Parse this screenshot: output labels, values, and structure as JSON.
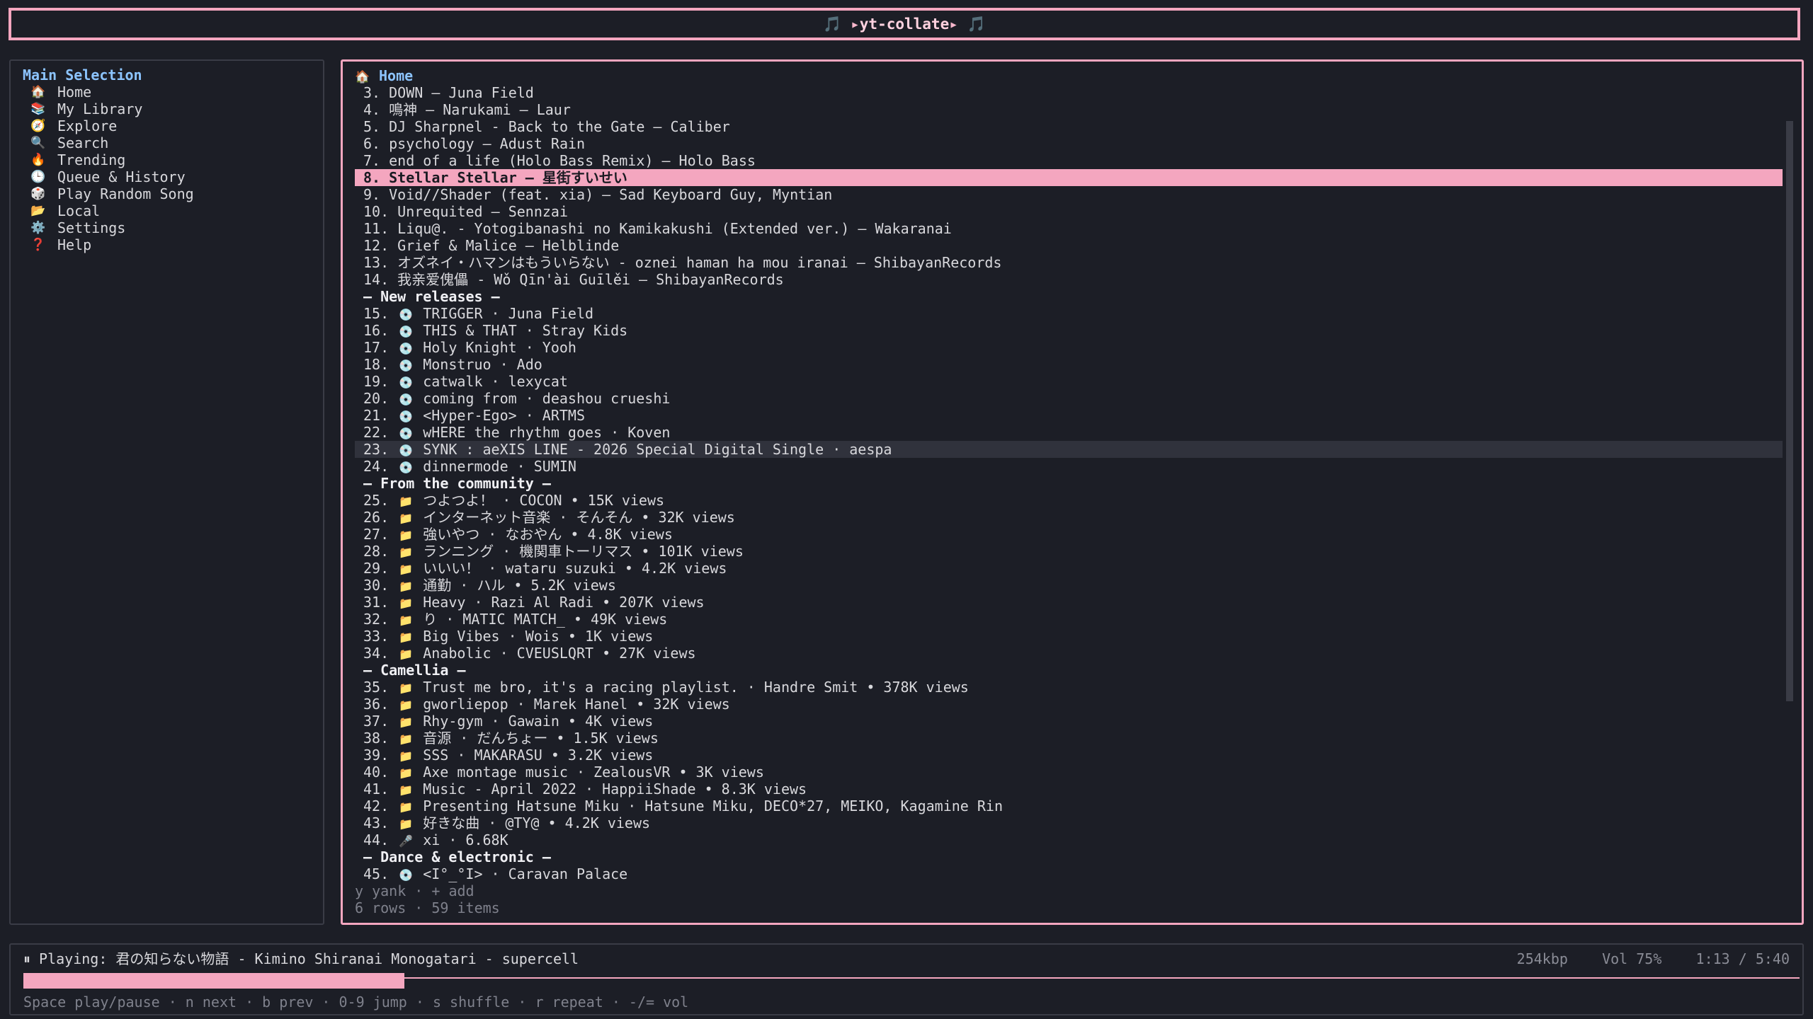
{
  "app_title": "yt-collate",
  "title_prefix": "🎵 ▸ ",
  "title_suffix": " ▸ 🎵",
  "colors": {
    "accent": "#f4a6bf",
    "heading": "#8cc4ff",
    "background": "#1c1e26"
  },
  "sidebar": {
    "heading": "Main Selection",
    "items": [
      {
        "icon": "🏠",
        "label": "Home"
      },
      {
        "icon": "📚",
        "label": "My Library"
      },
      {
        "icon": "🧭",
        "label": "Explore"
      },
      {
        "icon": "🔍",
        "label": "Search"
      },
      {
        "icon": "🔥",
        "label": "Trending"
      },
      {
        "icon": "🕒",
        "label": "Queue & History"
      },
      {
        "icon": "🎲",
        "label": "Play Random Song"
      },
      {
        "icon": "📂",
        "label": "Local"
      },
      {
        "icon": "⚙️",
        "label": "Settings"
      },
      {
        "icon": "❓",
        "label": "Help"
      }
    ]
  },
  "main": {
    "heading_icon": "🏠",
    "heading": "Home",
    "rows": [
      {
        "type": "item",
        "num": "3.",
        "text": "DOWN — Juna Field"
      },
      {
        "type": "item",
        "num": "4.",
        "text": "鳴神 — Narukami — Laur"
      },
      {
        "type": "item",
        "num": "5.",
        "text": "DJ Sharpnel - Back to the Gate — Caliber"
      },
      {
        "type": "item",
        "num": "6.",
        "text": "psychology — Adust Rain"
      },
      {
        "type": "item",
        "num": "7.",
        "text": "end of a life (Holo Bass Remix) — Holo Bass"
      },
      {
        "type": "item",
        "num": "8.",
        "text": "Stellar Stellar — 星街すいせい",
        "state": "selected"
      },
      {
        "type": "item",
        "num": "9.",
        "text": "Void//Shader (feat. xia) — Sad Keyboard Guy, Myntian"
      },
      {
        "type": "item",
        "num": "10.",
        "text": "Unrequited — Sennzai"
      },
      {
        "type": "item",
        "num": "11.",
        "text": "Liqu@. - Yotogibanashi no Kamikakushi (Extended ver.) — Wakaranai"
      },
      {
        "type": "item",
        "num": "12.",
        "text": "Grief & Malice — Helblinde"
      },
      {
        "type": "item",
        "num": "13.",
        "text": "オズネイ・ハマンはもういらない - oznei haman ha mou iranai — ShibayanRecords"
      },
      {
        "type": "item",
        "num": "14.",
        "text": "我亲爱傀儡 - Wǒ Qīn'ài Guīlěi — ShibayanRecords"
      },
      {
        "type": "section",
        "text": "— New releases —"
      },
      {
        "type": "item",
        "num": "15.",
        "icon": "💿",
        "text": "TRIGGER · Juna Field"
      },
      {
        "type": "item",
        "num": "16.",
        "icon": "💿",
        "text": "THIS & THAT · Stray Kids"
      },
      {
        "type": "item",
        "num": "17.",
        "icon": "💿",
        "text": "Holy Knight · Yooh"
      },
      {
        "type": "item",
        "num": "18.",
        "icon": "💿",
        "text": "Monstruo · Ado"
      },
      {
        "type": "item",
        "num": "19.",
        "icon": "💿",
        "text": "catwalk · lexycat"
      },
      {
        "type": "item",
        "num": "20.",
        "icon": "💿",
        "text": "coming from · deashou crueshi"
      },
      {
        "type": "item",
        "num": "21.",
        "icon": "💿",
        "text": "<Hyper-Ego> · ARTMS"
      },
      {
        "type": "item",
        "num": "22.",
        "icon": "💿",
        "text": "wHERE the rhythm goes · Koven"
      },
      {
        "type": "item",
        "num": "23.",
        "icon": "💿",
        "text": "SYNK : aeXIS LINE - 2026 Special Digital Single · aespa",
        "state": "hover"
      },
      {
        "type": "item",
        "num": "24.",
        "icon": "💿",
        "text": "dinnermode · SUMIN"
      },
      {
        "type": "section",
        "text": "— From the community —"
      },
      {
        "type": "item",
        "num": "25.",
        "icon": "📁",
        "text": "つよつよ！ · COCON • 15K views"
      },
      {
        "type": "item",
        "num": "26.",
        "icon": "📁",
        "text": "インターネット音楽 · そんそん • 32K views"
      },
      {
        "type": "item",
        "num": "27.",
        "icon": "📁",
        "text": "強いやつ · なおやん • 4.8K views"
      },
      {
        "type": "item",
        "num": "28.",
        "icon": "📁",
        "text": "ランニング · 機関車トーリマス • 101K views"
      },
      {
        "type": "item",
        "num": "29.",
        "icon": "📁",
        "text": "いいい！ · wataru suzuki • 4.2K views"
      },
      {
        "type": "item",
        "num": "30.",
        "icon": "📁",
        "text": "通勤 · ハル • 5.2K views"
      },
      {
        "type": "item",
        "num": "31.",
        "icon": "📁",
        "text": "Heavy · Razi Al Radi • 207K views"
      },
      {
        "type": "item",
        "num": "32.",
        "icon": "📁",
        "text": "り · MATIC MATCH_ • 49K views"
      },
      {
        "type": "item",
        "num": "33.",
        "icon": "📁",
        "text": "Big Vibes · Wois • 1K views"
      },
      {
        "type": "item",
        "num": "34.",
        "icon": "📁",
        "text": "Anabolic · CVEUSLQRT • 27K views"
      },
      {
        "type": "section",
        "text": "— Camellia —"
      },
      {
        "type": "item",
        "num": "35.",
        "icon": "📁",
        "text": "Trust me bro, it's a racing playlist. · Handre Smit • 378K views"
      },
      {
        "type": "item",
        "num": "36.",
        "icon": "📁",
        "text": "gworliepop · Marek Hanel • 32K views"
      },
      {
        "type": "item",
        "num": "37.",
        "icon": "📁",
        "text": "Rhy-gym · Gawain • 4K views"
      },
      {
        "type": "item",
        "num": "38.",
        "icon": "📁",
        "text": "音源 · だんちょー • 1.5K views"
      },
      {
        "type": "item",
        "num": "39.",
        "icon": "📁",
        "text": "SSS · MAKARASU • 3.2K views"
      },
      {
        "type": "item",
        "num": "40.",
        "icon": "📁",
        "text": "Axe montage music · ZealousVR • 3K views"
      },
      {
        "type": "item",
        "num": "41.",
        "icon": "📁",
        "text": "Music - April 2022 · HappiiShade • 8.3K views"
      },
      {
        "type": "item",
        "num": "42.",
        "icon": "📁",
        "text": "Presenting Hatsune Miku · Hatsune Miku, DECO*27, MEIKO, Kagamine Rin"
      },
      {
        "type": "item",
        "num": "43.",
        "icon": "📁",
        "text": "好きな曲 · @TY@ • 4.2K views"
      },
      {
        "type": "item",
        "num": "44.",
        "icon": "🎤",
        "text": "xi · 6.68K"
      },
      {
        "type": "section",
        "text": "— Dance & electronic —"
      },
      {
        "type": "item",
        "num": "45.",
        "icon": "💿",
        "text": "<I°_°I> · Caravan Palace"
      }
    ],
    "hint_keys": "y yank · + add",
    "hint_count": "6 rows · 59 items"
  },
  "player": {
    "status_icon": "⏸",
    "status": "Playing: 君の知らない物語 - Kimino Shiranai Monogatari - supercell",
    "bitrate": "254kbp",
    "volume": "Vol 75%",
    "time": "1:13 / 5:40",
    "progress_fraction": 0.2147,
    "keys": "Space play/pause · n next · b prev · 0-9 jump · s shuffle · r repeat · -/= vol"
  }
}
